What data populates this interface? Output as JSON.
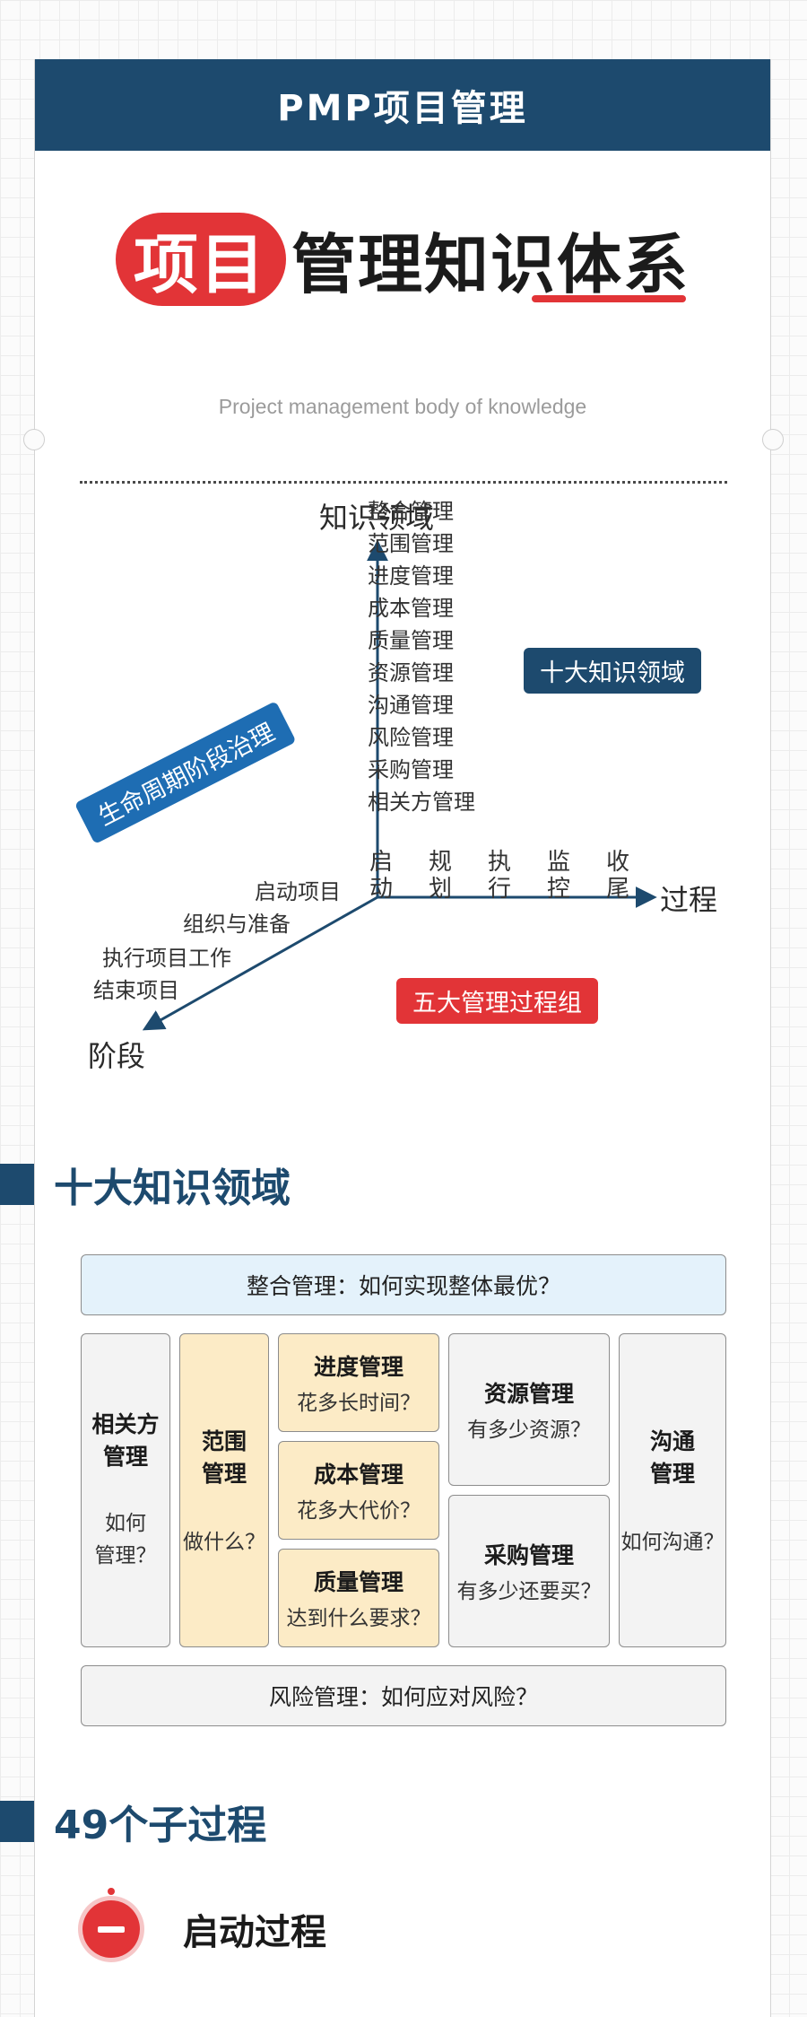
{
  "header": {
    "title": "PMP项目管理"
  },
  "hero": {
    "title_highlight": "项目",
    "title_rest": "管理知识体系",
    "subtitle": "Project management body of knowledge"
  },
  "axes": {
    "y_label": "知识领域",
    "x_label": "过程",
    "z_label": "阶段"
  },
  "knowledge_areas": [
    "整合管理",
    "范围管理",
    "进度管理",
    "成本管理",
    "质量管理",
    "资源管理",
    "沟通管理",
    "风险管理",
    "采购管理",
    "相关方管理"
  ],
  "tags": {
    "ten_areas": "十大知识领域",
    "lifecycle": "生命周期阶段治理",
    "five_groups": "五大管理过程组"
  },
  "process_groups": [
    {
      "top": "启",
      "bottom": "动"
    },
    {
      "top": "规",
      "bottom": "划"
    },
    {
      "top": "执",
      "bottom": "行"
    },
    {
      "top": "监",
      "bottom": "控"
    },
    {
      "top": "收",
      "bottom": "尾"
    }
  ],
  "phases": [
    "启动项目",
    "组织与准备",
    "执行项目工作",
    "结束项目"
  ],
  "section1": {
    "title": "十大知识领域"
  },
  "grid": {
    "integration": "整合管理：如何实现整体最优？",
    "stakeholder": {
      "title_1": "相关方",
      "title_2": "管理",
      "sub_1": "如何",
      "sub_2": "管理？"
    },
    "scope": {
      "title_1": "范围",
      "title_2": "管理",
      "sub": "做什么？"
    },
    "schedule": {
      "title": "进度管理",
      "sub": "花多长时间？"
    },
    "cost": {
      "title": "成本管理",
      "sub": "花多大代价？"
    },
    "quality": {
      "title": "质量管理",
      "sub": "达到什么要求？"
    },
    "resource": {
      "title": "资源管理",
      "sub": "有多少资源？"
    },
    "procurement": {
      "title": "采购管理",
      "sub": "有多少还要买？"
    },
    "communication": {
      "title_1": "沟通",
      "title_2": "管理",
      "sub": "如何沟通？"
    },
    "risk": "风险管理：如何应对风险？"
  },
  "section2": {
    "title": "49个子过程"
  },
  "subsection": {
    "title": "启动过程"
  },
  "colors": {
    "navy": "#1d4a6e",
    "red": "#e23437",
    "blue": "#1e6db3",
    "light_blue": "#e4f2fb",
    "light_yellow": "#fcebc6"
  }
}
